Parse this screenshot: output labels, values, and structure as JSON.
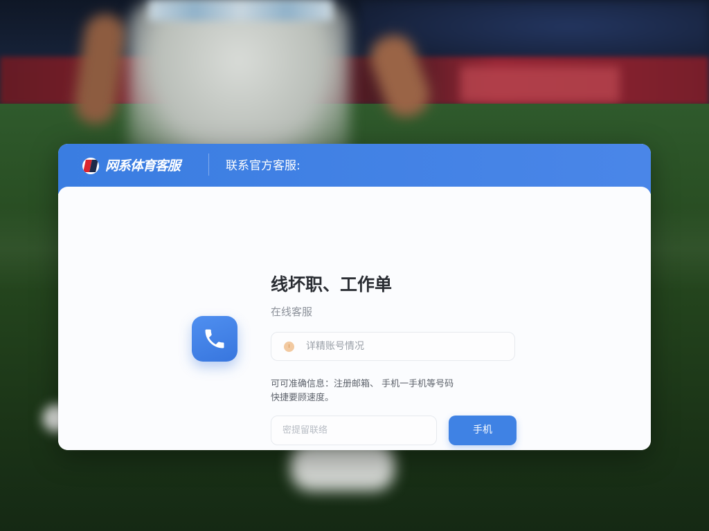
{
  "header": {
    "brand_name": "网系体育客服",
    "contact_label": "联系官方客服:"
  },
  "main": {
    "title": "线坏职、工作单",
    "subtitle": "在线客服",
    "account_field_placeholder": "详精账号情况",
    "info_line_1": "可可准确信息：注册邮箱、  手机一手机等号码",
    "info_line_2": "快捷要顾速度。",
    "contact_input_placeholder": "密提留联络",
    "submit_label": "手机"
  },
  "colors": {
    "accent": "#3f82e4",
    "header_bg": "#3a7de1",
    "card_bg": "#fbfcfe"
  },
  "icons": {
    "brand": "brand-logo-icon",
    "phone": "phone-icon",
    "account_dot": "info-dot-icon"
  }
}
